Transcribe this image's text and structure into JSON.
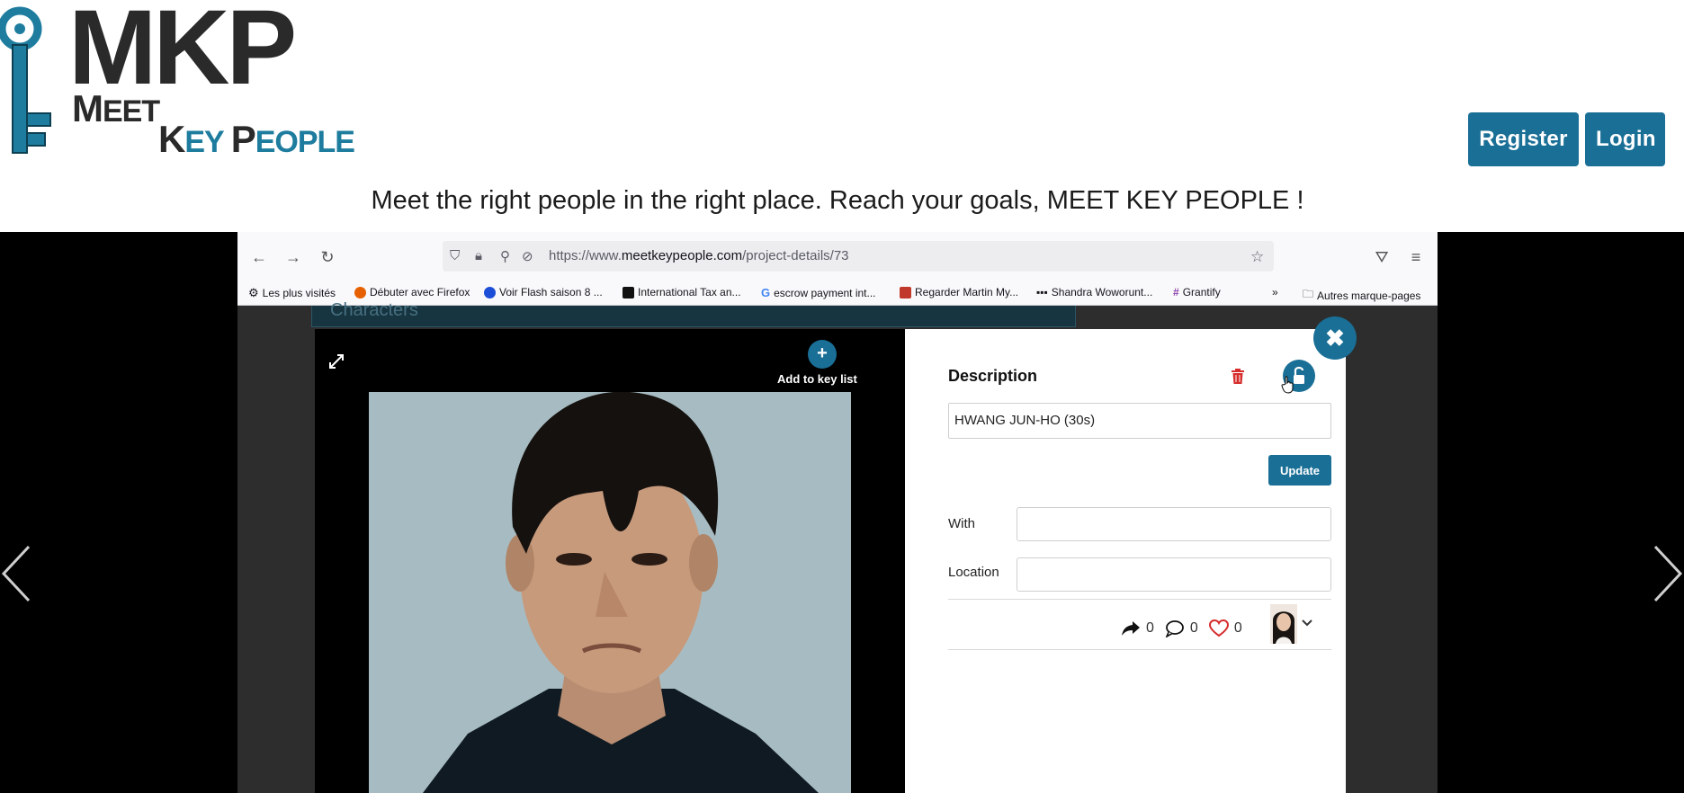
{
  "site": {
    "logo": {
      "mark": "MKP",
      "word1_first": "M",
      "word1_rest": "EET",
      "word2_k": "K",
      "word2_ey": "EY",
      "word2_p": "P",
      "word2_eople": "EOPLE"
    },
    "register_label": "Register",
    "login_label": "Login",
    "tagline": "Meet the right people in the right place. Reach your goals, MEET KEY PEOPLE !"
  },
  "browser": {
    "url_prefix": "https://www.",
    "url_host": "meetkeypeople.com",
    "url_path": "/project-details/73",
    "bookmarks": [
      {
        "label": "Les plus visités"
      },
      {
        "label": "Débuter avec Firefox"
      },
      {
        "label": "Voir Flash saison 8 ..."
      },
      {
        "label": "International Tax an..."
      },
      {
        "label": "escrow payment int..."
      },
      {
        "label": "Regarder Martin My..."
      },
      {
        "label": "Shandra Woworunt..."
      },
      {
        "label": "Grantify"
      },
      {
        "label": "Autres marque-pages"
      }
    ],
    "underlay_text": "Characters"
  },
  "modal": {
    "add_key_list_label": "Add to key list",
    "description_title": "Description",
    "description_value": "HWANG JUN-HO (30s)",
    "update_label": "Update",
    "with_label": "With",
    "location_label": "Location",
    "shares": "0",
    "comments": "0",
    "likes": "0"
  },
  "colors": {
    "brand_blue": "#1a6f96",
    "logo_blue": "#1e7d9e",
    "trash_red": "#d62c2c"
  },
  "icons": [
    "key-logo-icon",
    "expand-icon",
    "plus-icon",
    "trash-icon",
    "unlock-icon",
    "close-icon",
    "share-icon",
    "comment-icon",
    "heart-icon",
    "chevron-down-icon",
    "chevron-left-icon",
    "chevron-right-icon"
  ]
}
